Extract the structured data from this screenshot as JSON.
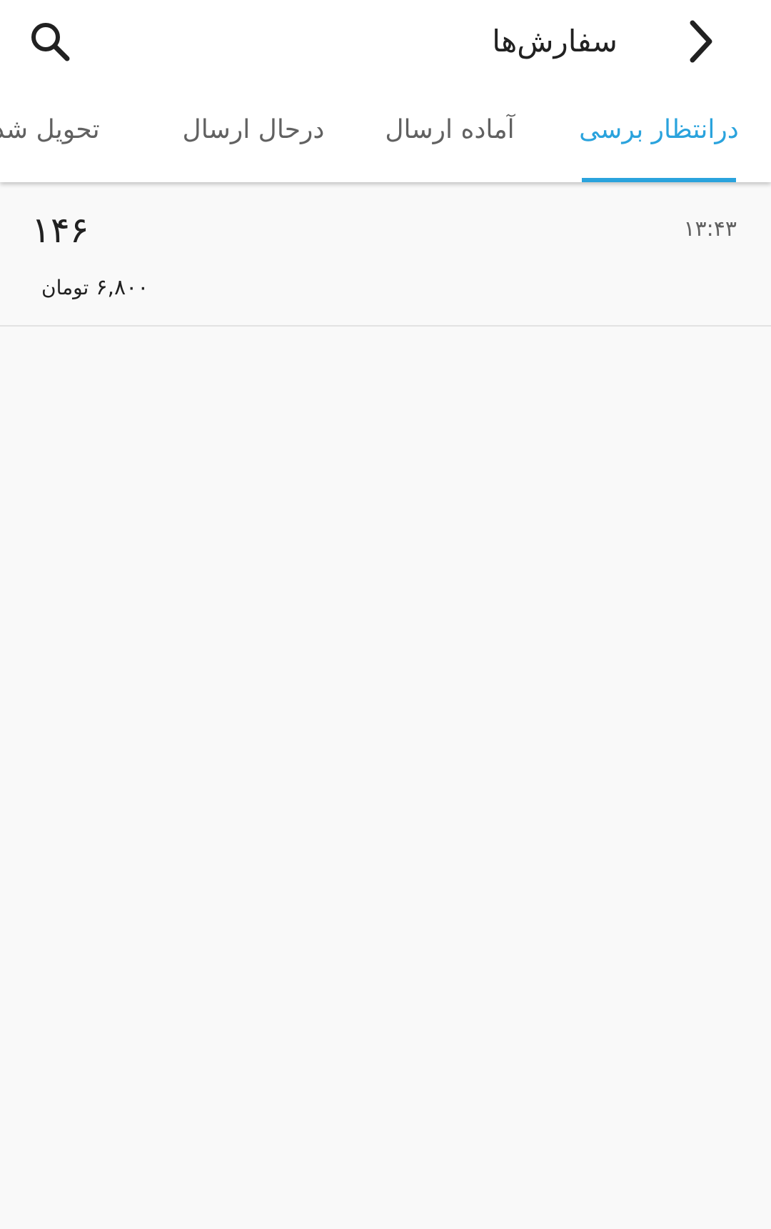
{
  "header": {
    "title": "سفارش‌ها",
    "back_icon": "chevron-right-icon",
    "search_icon": "search-icon"
  },
  "tabs": [
    {
      "label": "درانتظار برسی",
      "active": true
    },
    {
      "label": "آماده ارسال",
      "active": false
    },
    {
      "label": "درحال ارسال",
      "active": false
    },
    {
      "label": "تحویل شد",
      "active": false
    }
  ],
  "orders": [
    {
      "number": "۱۴۶",
      "time": "۱۳:۴۳",
      "amount": "۶,۸۰۰",
      "currency": "تومان"
    }
  ],
  "colors": {
    "accent": "#2aa3dd",
    "text_primary": "#212121",
    "text_secondary": "#616161",
    "background": "#f9f9f9"
  }
}
